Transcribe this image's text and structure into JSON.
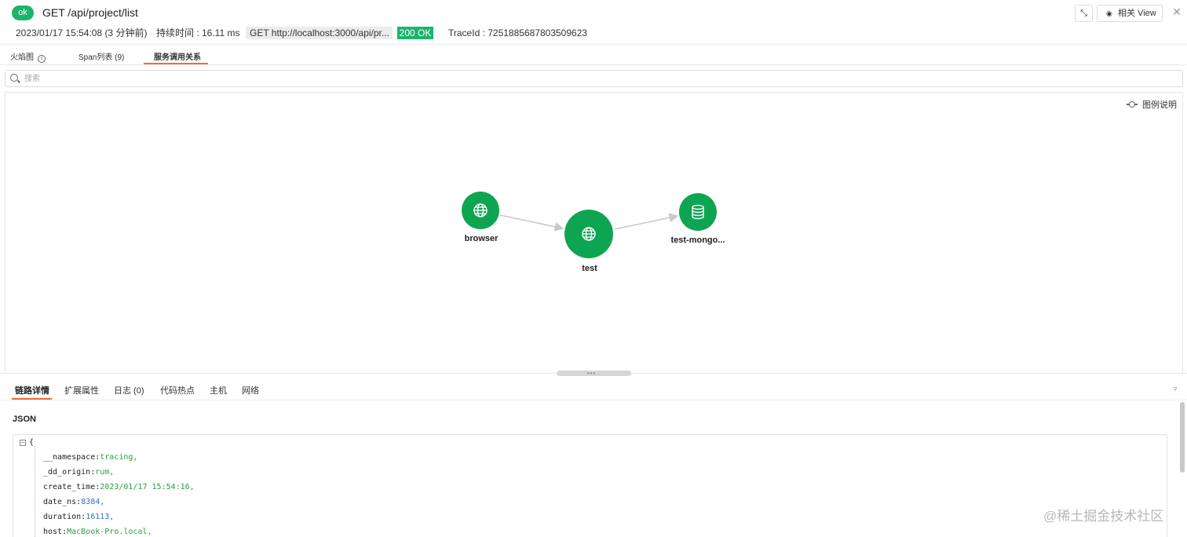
{
  "header": {
    "status_pill": "ok",
    "title": "GET /api/project/list",
    "compress_icon": "compress-icon",
    "related_view_label": "相关 View",
    "close_label": "✕"
  },
  "meta": {
    "datetime": "2023/01/17 15:54:08 (3 分钟前)",
    "duration": "持续时间 : 16.11 ms",
    "url": "GET   http://localhost:3000/api/pr...",
    "status_code": "200 OK",
    "trace_id": "TraceId : 7251885687803509623"
  },
  "tabs": [
    {
      "label": "火焰图"
    },
    {
      "label": "Span列表 (9)"
    },
    {
      "label": "服务调用关系"
    }
  ],
  "search": {
    "placeholder": "搜索"
  },
  "graph": {
    "legend_label": "图例说明",
    "nodes": [
      {
        "label": "browser",
        "icon": "globe-icon"
      },
      {
        "label": "test",
        "icon": "globe-icon"
      },
      {
        "label": "test-mongo...",
        "icon": "database-icon"
      }
    ],
    "node_color": "#0ea552",
    "edge_color": "#c8c8c8"
  },
  "bottom_tabs": [
    {
      "label": "链路详情"
    },
    {
      "label": "扩展属性"
    },
    {
      "label": "日志 (0)"
    },
    {
      "label": "代码热点"
    },
    {
      "label": "主机"
    },
    {
      "label": "网络"
    }
  ],
  "json_section": {
    "title": "JSON",
    "open_brace": "{",
    "lines": [
      {
        "key": "__namespace",
        "value": "tracing,",
        "type": "str"
      },
      {
        "key": "_dd_origin",
        "value": "rum,",
        "type": "str"
      },
      {
        "key": "create_time",
        "value": "2023/01/17 15:54:16,",
        "type": "str"
      },
      {
        "key": "date_ns",
        "value": "8384,",
        "type": "num"
      },
      {
        "key": "duration",
        "value": "16113,",
        "type": "num"
      },
      {
        "key": "host",
        "value": "MacBook-Pro.local,",
        "type": "str"
      }
    ]
  },
  "watermark": "@稀土掘金技术社区",
  "colors": {
    "accent": "#f26b3a",
    "ok_green": "#1db36b",
    "json_string": "#2a9d3f",
    "json_number": "#2d72c4"
  }
}
